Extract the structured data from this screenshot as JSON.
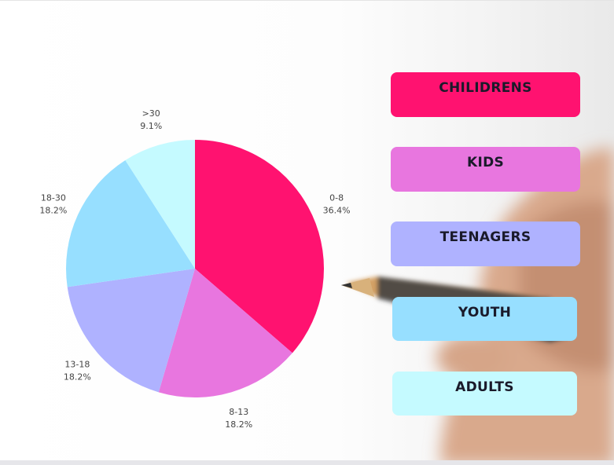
{
  "chart_data": {
    "type": "pie",
    "slices": [
      {
        "label": "0-8",
        "value": 36.4,
        "value_label": "36.4%",
        "color": "#ff1270"
      },
      {
        "label": "8-13",
        "value": 18.2,
        "value_label": "18.2%",
        "color": "#e876df"
      },
      {
        "label": "13-18",
        "value": 18.2,
        "value_label": "18.2%",
        "color": "#afb2ff"
      },
      {
        "label": "18-30",
        "value": 18.2,
        "value_label": "18.2%",
        "color": "#97dfff"
      },
      {
        "label": ">30",
        "value": 9.1,
        "value_label": "9.1%",
        "color": "#c5faff"
      }
    ]
  },
  "legend": {
    "items": [
      {
        "label": "CHILIDRENS",
        "color": "#ff1270"
      },
      {
        "label": "KIDS",
        "color": "#e876df"
      },
      {
        "label": "TEENAGERS",
        "color": "#afb2ff"
      },
      {
        "label": "YOUTH",
        "color": "#97dfff"
      },
      {
        "label": "ADULTS",
        "color": "#c5faff"
      }
    ]
  }
}
